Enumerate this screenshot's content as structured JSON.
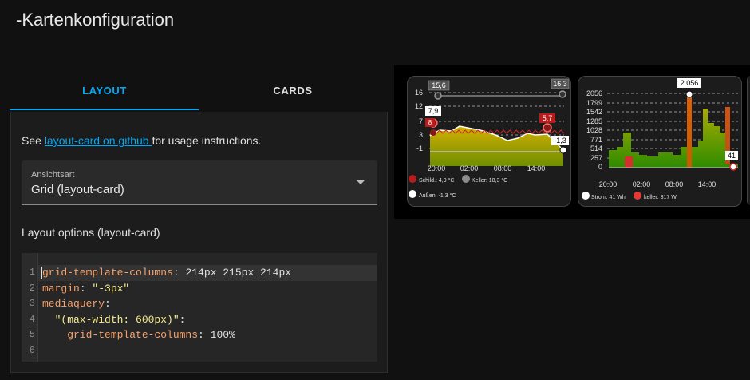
{
  "page": {
    "title": "-Kartenkonfiguration"
  },
  "tabs": [
    {
      "label": "LAYOUT",
      "active": true
    },
    {
      "label": "CARDS",
      "active": false
    }
  ],
  "editor": {
    "usage_prefix": "See ",
    "usage_link": "layout-card on github ",
    "usage_suffix": "for usage instructions.",
    "view_type": {
      "label": "Ansichtsart",
      "value": "Grid (layout-card)"
    },
    "layout_options_label": "Layout options (layout-card)",
    "code_lines": [
      {
        "n": "1",
        "key": "grid-template-columns",
        "sep": ": ",
        "val": "214px 215px 214px",
        "val_type": "plain"
      },
      {
        "n": "2",
        "key": "margin",
        "sep": ": ",
        "val": "\"-3px\"",
        "val_type": "string"
      },
      {
        "n": "3",
        "key": "mediaquery",
        "sep": ":",
        "val": "",
        "val_type": "plain"
      },
      {
        "n": "4",
        "key": "  \"(max-width: 600px)\"",
        "sep": ":",
        "val": "",
        "val_type": "string-key"
      },
      {
        "n": "5",
        "key": "    grid-template-columns",
        "sep": ": ",
        "val": "100%",
        "val_type": "plain"
      },
      {
        "n": "6",
        "key": "",
        "sep": "",
        "val": "",
        "val_type": "plain"
      }
    ]
  },
  "preview": {
    "temperature_card": {
      "y_ticks": [
        "16",
        "12",
        "7",
        "3",
        "-1"
      ],
      "x_ticks": [
        "20:00",
        "02:00",
        "08:00",
        "14:00"
      ],
      "callouts": {
        "max": "15,6",
        "max_right": "16,3",
        "left": "7,9",
        "left2": "8",
        "mid": "5,7",
        "end": "-1,3"
      },
      "legend": [
        {
          "label": "Schild.: 4,9 °C",
          "color": "#b71c1c"
        },
        {
          "label": "Keller: 18,3 °C",
          "color": "#8c8c8c"
        },
        {
          "label": "Außen: -1,3 °C",
          "color": "#ffffff"
        }
      ]
    },
    "power_card": {
      "y_ticks": [
        "2056",
        "1799",
        "1542",
        "1285",
        "1028",
        "771",
        "514",
        "257",
        "0"
      ],
      "x_ticks": [
        "20:00",
        "02:00",
        "08:00",
        "14:00"
      ],
      "callouts": {
        "max": "2.056",
        "end": "41"
      },
      "legend": [
        {
          "label": "Strom: 41 Wh",
          "color": "#ffffff"
        },
        {
          "label": "keller: 317 W",
          "color": "#e53935"
        }
      ]
    },
    "colors": {
      "accent": "#03a9f4",
      "area_top": "#c8b400",
      "area_bottom": "#7a9a00",
      "alert": "#d32f2f"
    }
  }
}
